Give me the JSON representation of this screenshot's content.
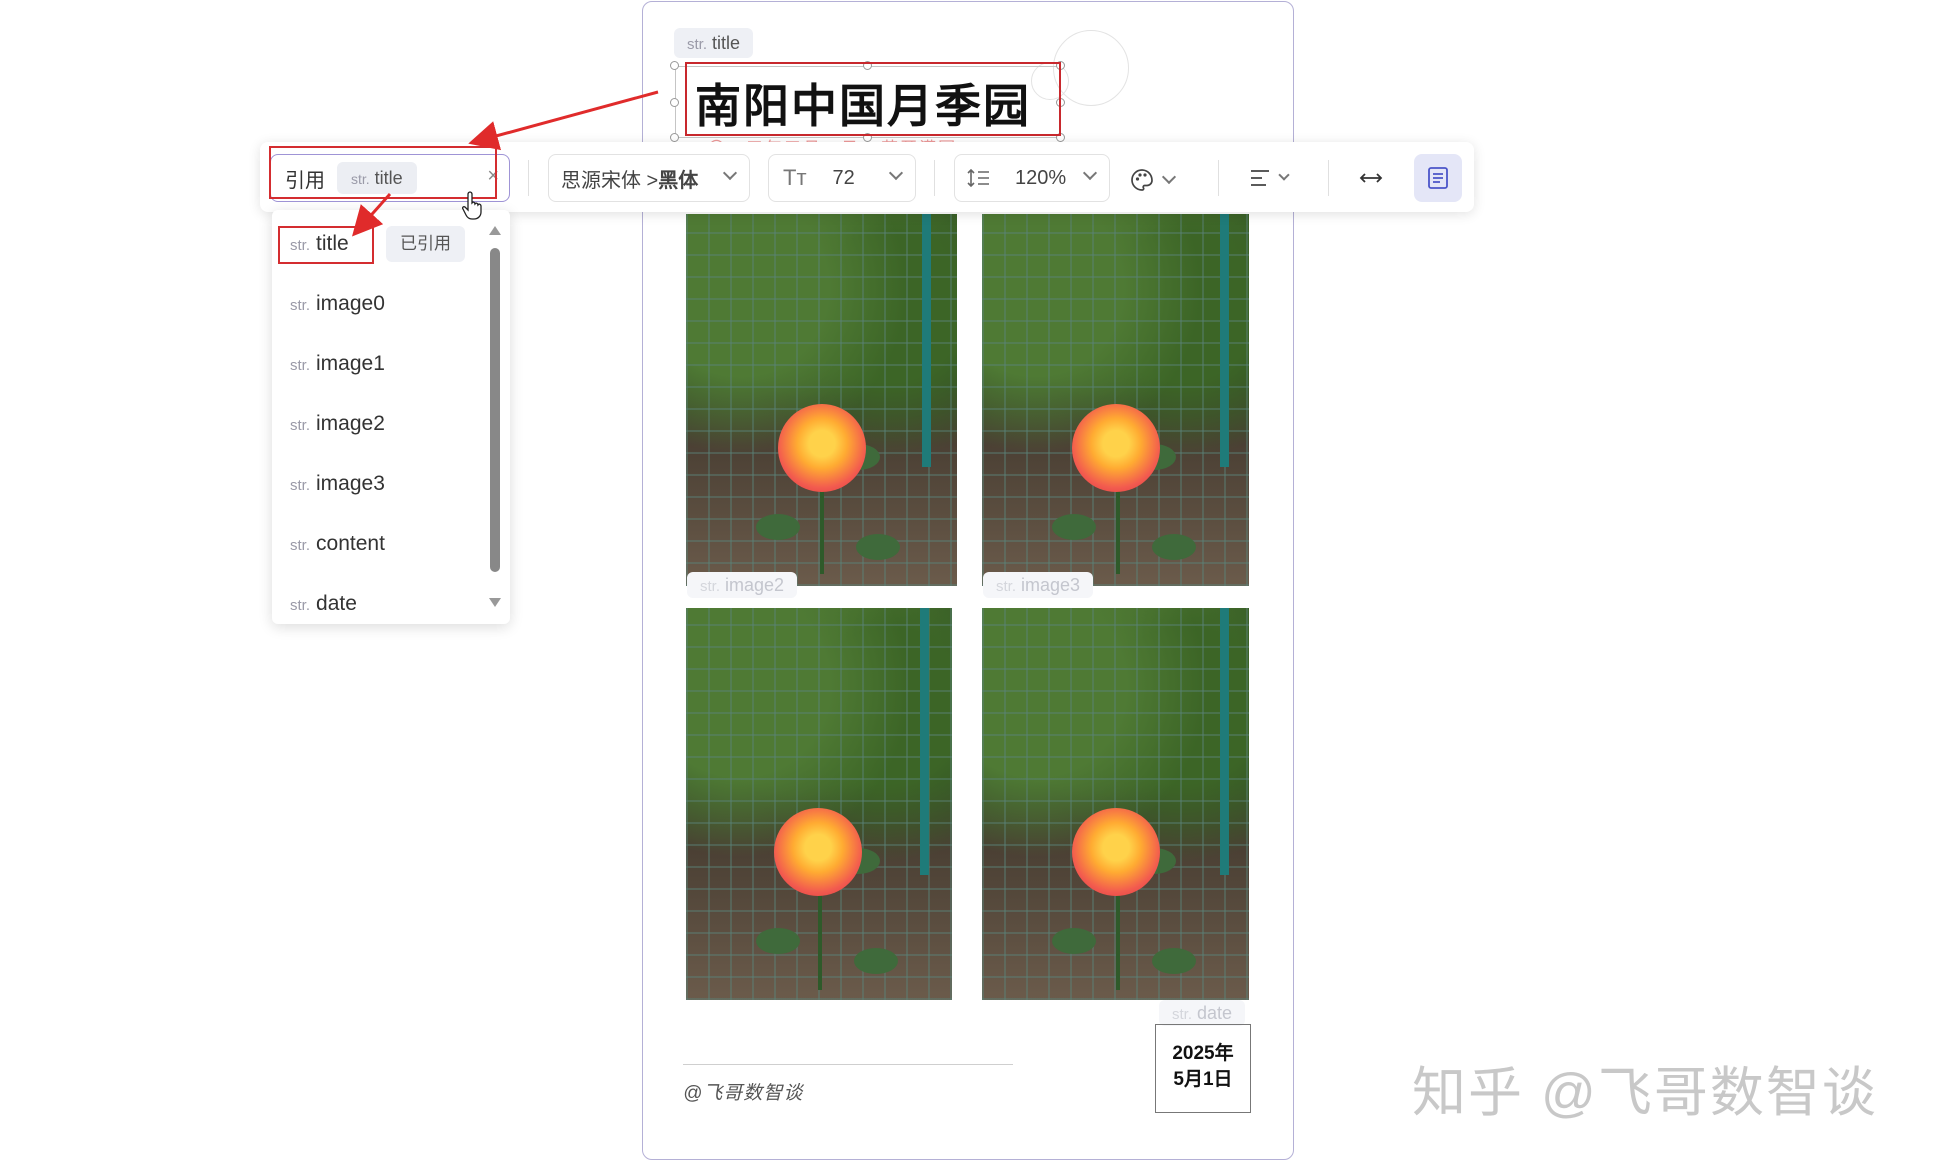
{
  "poster": {
    "title_tag": {
      "prefix": "str.",
      "name": "title"
    },
    "title": "南阳中国月季园",
    "subtitle_ghost": "二〇二五年五月一日 · 花开满园",
    "image_tags": [
      {
        "prefix": "str.",
        "name": "image2"
      },
      {
        "prefix": "str.",
        "name": "image3"
      }
    ],
    "date_tag": {
      "prefix": "str.",
      "name": "date"
    },
    "date_line1": "2025年",
    "date_line2": "5月1日",
    "caption": "@飞哥数智谈"
  },
  "toolbar": {
    "ref_label": "引用",
    "ref_chip": {
      "prefix": "str.",
      "name": "title"
    },
    "clear_icon": "×",
    "font_family": "思源宋体 > ",
    "font_weight": "黑体",
    "font_size_icon": "Tт",
    "font_size": "72",
    "line_height": "120%",
    "icons": {
      "line_height": "line-height-icon",
      "color": "palette-icon",
      "align": "align-icon",
      "spacing": "letter-spacing-icon",
      "text_panel": "text-panel-icon"
    }
  },
  "dropdown": {
    "items": [
      {
        "prefix": "str.",
        "name": "title"
      },
      {
        "prefix": "str.",
        "name": "image0"
      },
      {
        "prefix": "str.",
        "name": "image1"
      },
      {
        "prefix": "str.",
        "name": "image2"
      },
      {
        "prefix": "str.",
        "name": "image3"
      },
      {
        "prefix": "str.",
        "name": "content"
      },
      {
        "prefix": "str.",
        "name": "date"
      }
    ],
    "used_badge": "已引用"
  },
  "watermark": "知乎 @飞哥数智谈",
  "colors": {
    "accent": "#9f94d6",
    "annotation_red": "#d42d30",
    "panel_active": "#e4e6f7"
  }
}
